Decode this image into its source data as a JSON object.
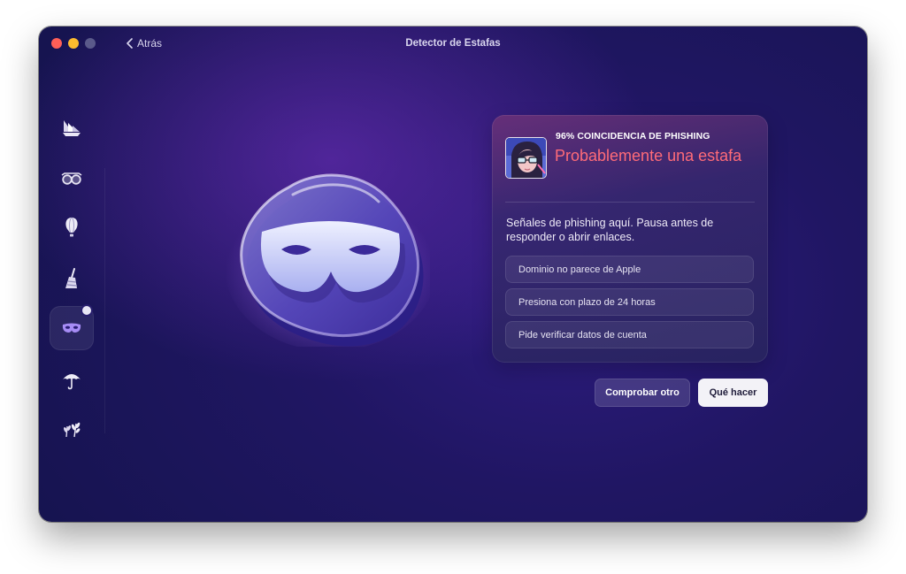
{
  "window": {
    "title": "Detector de Estafas",
    "back_label": "Atrás"
  },
  "sidebar": {
    "items": [
      {
        "icon": "ship-icon"
      },
      {
        "icon": "glasses-icon"
      },
      {
        "icon": "balloon-icon"
      },
      {
        "icon": "broom-icon"
      },
      {
        "icon": "mask-icon",
        "active": true,
        "badge": "notification-dot"
      },
      {
        "icon": "umbrella-icon"
      },
      {
        "icon": "plants-icon"
      }
    ]
  },
  "result": {
    "match_label": "96% COINCIDENCIA DE PHISHING",
    "verdict": "Probablemente una estafa",
    "description": "Señales de phishing aquí. Pausa antes de responder o abrir enlaces.",
    "signals": [
      "Dominio no parece de Apple",
      "Presiona con plazo de 24 horas",
      "Pide verificar datos de cuenta"
    ]
  },
  "actions": {
    "check_another": "Comprobar otro",
    "what_to_do": "Qué hacer"
  },
  "colors": {
    "verdict": "#ff6b78",
    "background": "#201663",
    "primary_button": "#f3f2f7"
  }
}
